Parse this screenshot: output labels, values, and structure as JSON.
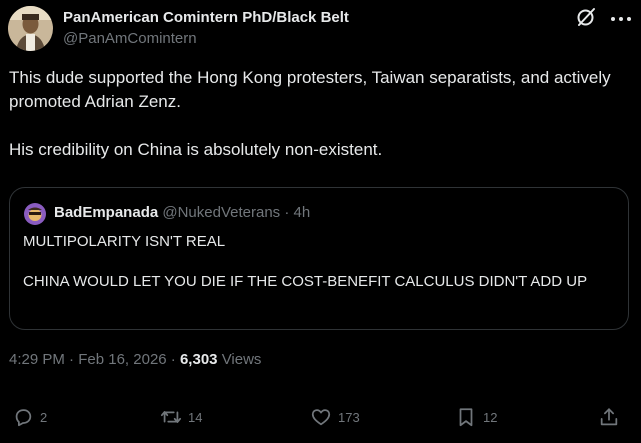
{
  "author": {
    "display_name": "PanAmerican Comintern PhD/Black Belt",
    "handle": "@PanAmComintern"
  },
  "tweet": {
    "paragraph_1": "This dude supported the Hong Kong protesters, Taiwan separatists, and actively promoted Adrian Zenz.",
    "paragraph_2": "His credibility on China is absolutely non-existent."
  },
  "quoted_tweet": {
    "display_name": "BadEmpanada",
    "handle": "@NukedVeterans",
    "separator": "·",
    "time": "4h",
    "paragraph_1": "MULTIPOLARITY ISN'T REAL",
    "paragraph_2": "CHINA WOULD LET YOU DIE IF THE COST-BENEFIT CALCULUS DIDN'T ADD UP"
  },
  "meta": {
    "time": "4:29 PM",
    "separator_1": "·",
    "date": "Feb 16, 2026",
    "separator_2": "·",
    "views_count": "6,303",
    "views_label": "Views"
  },
  "actions": {
    "replies": "2",
    "reposts": "14",
    "likes": "173",
    "bookmarks": "12"
  },
  "icons": {
    "grok": "grok-icon",
    "more": "more-icon",
    "reply": "reply-icon",
    "repost": "repost-icon",
    "like": "heart-icon",
    "bookmark": "bookmark-icon",
    "share": "share-icon"
  },
  "colors": {
    "background": "#000000",
    "text_primary": "#e7e9ea",
    "text_secondary": "#71767b",
    "border": "#2f3336"
  }
}
